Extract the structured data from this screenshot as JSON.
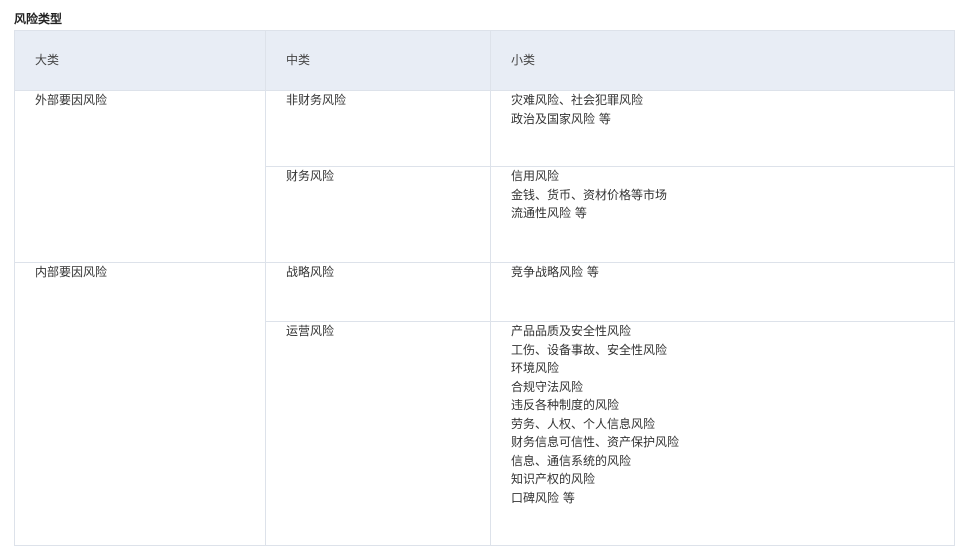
{
  "title": "风险类型",
  "headers": [
    "大类",
    "中类",
    "小类"
  ],
  "groups": [
    {
      "major": "外部要因风险",
      "rows": [
        {
          "middle": "非财务风险",
          "minor": [
            "灾难风险、社会犯罪风险",
            "政治及国家风险 等"
          ]
        },
        {
          "middle": "财务风险",
          "minor": [
            "信用风险",
            "金钱、货币、资材价格等市场",
            "流通性风险 等"
          ]
        }
      ]
    },
    {
      "major": "内部要因风险",
      "rows": [
        {
          "middle": "战略风险",
          "minor": [
            "竞争战略风险 等"
          ]
        },
        {
          "middle": "运营风险",
          "minor": [
            "产品品质及安全性风险",
            "工伤、设备事故、安全性风险",
            "环境风险",
            "合规守法风险",
            "违反各种制度的风险",
            "劳务、人权、个人信息风险",
            "财务信息可信性、资产保护风险",
            "信息、通信系统的风险",
            "知识产权的风险",
            "口碑风险 等"
          ]
        }
      ]
    }
  ]
}
